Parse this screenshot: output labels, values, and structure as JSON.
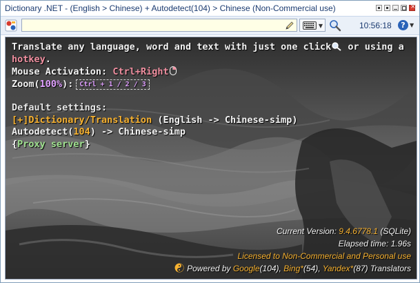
{
  "window": {
    "title": "Dictionary .NET - (English > Chinese) + Autodetect(104) > Chinese (Non-Commercial use)"
  },
  "toolbar": {
    "search_value": "",
    "clock": "10:56:18",
    "icons": [
      "app-icon",
      "pen-icon",
      "keyboard-icon",
      "search-icon",
      "help-icon"
    ]
  },
  "intro": {
    "line1": "Translate any language, word and text with just one click",
    "line1b": "or using a",
    "hotkey": "hotkey",
    "hotkey_suffix": "."
  },
  "mouse": {
    "label": "Mouse Activation: ",
    "value": "Ctrl+Right"
  },
  "zoom": {
    "label": "Zoom(",
    "percent": "100%",
    "close": "):",
    "keys": "Ctrl + 1 / 2 / 3"
  },
  "defaults": {
    "heading": "Default settings:",
    "dict_link": "[+]Dictionary/Translation",
    "dict_pair": " (English -> Chinese-simp)",
    "autodetect_label": "Autodetect(",
    "autodetect_count": "104",
    "autodetect_pair": ") -> Chinese-simp",
    "proxy_open": "{",
    "proxy_link": "Proxy server",
    "proxy_close": "}"
  },
  "info": {
    "version_label": "Current Version: ",
    "version_value": "9.4.6778.1",
    "version_db": " (SQLite)",
    "elapsed": "Elapsed time: 1.96s",
    "license": "Licensed to Non-Commercial and Personal use",
    "powered_label": "Powered by ",
    "google": "Google",
    "google_count": "(104), ",
    "bing": "Bing*",
    "bing_count": "(54), ",
    "yandex": "Yandex*",
    "yandex_count": "(87) Translators"
  },
  "colors": {
    "pink": "#f08fa0",
    "violet": "#e0a0ff",
    "orange": "#f7b231",
    "green": "#9fe08f",
    "title_text": "#1a3a70"
  }
}
